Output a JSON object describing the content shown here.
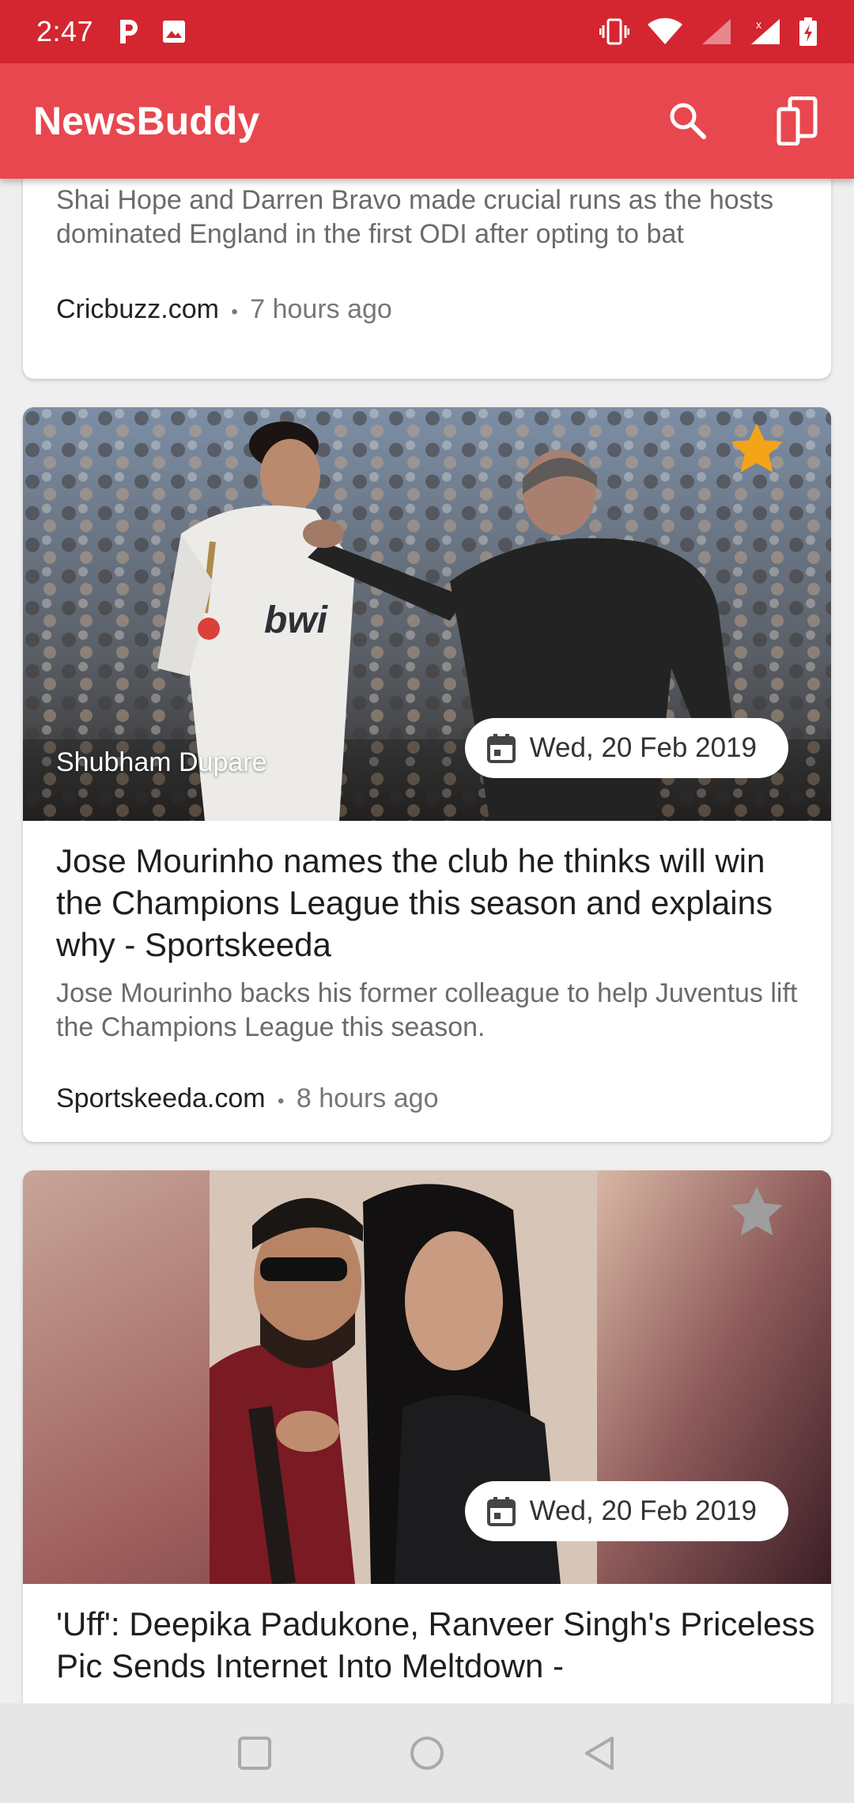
{
  "status_bar": {
    "time": "2:47"
  },
  "app_bar": {
    "title": "NewsBuddy"
  },
  "cards": [
    {
      "description": "Shai Hope and Darren Bravo made crucial runs as the hosts dominated England in the first ODI after opting to bat",
      "source": "Cricbuzz.com",
      "separator": "•",
      "time_ago": "7 hours ago"
    },
    {
      "author": "Shubham Dupare",
      "date": "Wed, 20 Feb 2019",
      "starred": true,
      "title": "Jose Mourinho names the club he thinks will win the Champions League this season and explains why - Sportskeeda",
      "description": "Jose Mourinho backs his former colleague to help Juventus lift the Champions League this season.",
      "source": "Sportskeeda.com",
      "separator": "•",
      "time_ago": "8 hours ago"
    },
    {
      "date": "Wed, 20 Feb 2019",
      "starred": false,
      "title": "'Uff': Deepika Padukone, Ranveer Singh's Priceless Pic Sends Internet Into Meltdown -"
    }
  ],
  "colors": {
    "status_bar": "#d32630",
    "app_bar": "#e8474f",
    "star_active": "#f4a418",
    "star_inactive": "#9e9e9e"
  }
}
